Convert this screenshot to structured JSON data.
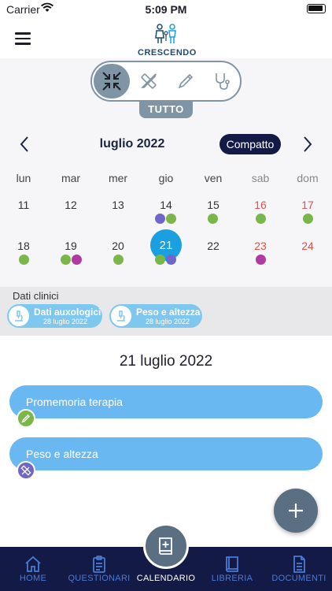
{
  "status_bar": {
    "carrier": "Carrier",
    "time": "5:09 PM"
  },
  "header": {
    "logo_text": "CRESCENDO"
  },
  "filters": {
    "selected_label": "TUTTO",
    "items": [
      {
        "icon": "compress-arrows-icon"
      },
      {
        "icon": "ruler-pencil-icon"
      },
      {
        "icon": "pencil-icon"
      },
      {
        "icon": "stethoscope-icon"
      }
    ]
  },
  "calendar": {
    "month_title": "luglio 2022",
    "view_toggle_label": "Compatto",
    "weekdays": [
      "lun",
      "mar",
      "mer",
      "gio",
      "ven",
      "sab",
      "dom"
    ],
    "week1": [
      "11",
      "12",
      "13",
      "14",
      "15",
      "16",
      "17"
    ],
    "week2": [
      "18",
      "19",
      "20",
      "21",
      "22",
      "23",
      "24"
    ],
    "today": "21"
  },
  "clinical": {
    "title": "Dati clinici",
    "chips": [
      {
        "title": "Dati auxologici",
        "date": "28 luglio 2022"
      },
      {
        "title": "Peso e altezza",
        "date": "28 luglio 2022"
      }
    ]
  },
  "detail": {
    "date_title": "21 luglio 2022",
    "events": [
      {
        "label": "Promemoria terapia",
        "badge": "green"
      },
      {
        "label": "Peso e altezza",
        "badge": "purple"
      }
    ]
  },
  "tabs": [
    {
      "label": "HOME",
      "icon": "home-icon"
    },
    {
      "label": "QUESTIONARI",
      "icon": "clipboard-icon"
    },
    {
      "label": "CALENDARIO",
      "icon": "calendar-book-icon"
    },
    {
      "label": "LIBRERIA",
      "icon": "book-icon"
    },
    {
      "label": "DOCUMENTI",
      "icon": "document-icon"
    }
  ],
  "colors": {
    "accent_blue": "#1aa0e0",
    "event_blue": "#6ab8f2",
    "navy": "#141a46",
    "slate": "#7f94a4",
    "dot_green": "#7ab648",
    "dot_purple": "#6e66c8",
    "dot_magenta": "#b23a9f"
  }
}
